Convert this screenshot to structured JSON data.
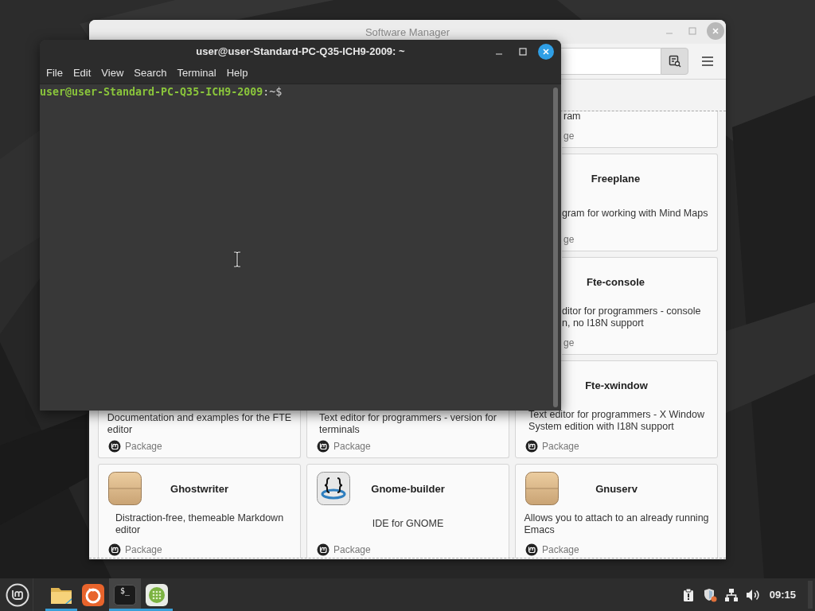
{
  "software_manager": {
    "title": "Software Manager",
    "cards": [
      {
        "kind": "clipped",
        "description": [
          "ram"
        ],
        "source": "ge"
      },
      {
        "kind": "partial",
        "name": "Freeplane",
        "description": [
          "gram for working with Mind Maps"
        ],
        "source": "ge"
      },
      {
        "kind": "partial",
        "name": "Fte-console",
        "description": [
          "ditor for programmers - console",
          "n, no I18N support"
        ],
        "source": "ge"
      },
      {
        "kind": "lower",
        "description": [
          "Documentation and examples for the FTE",
          "editor"
        ],
        "source": "Package"
      },
      {
        "kind": "lower",
        "description": [
          "Text editor for programmers - version for",
          "terminals"
        ],
        "source": "Package"
      },
      {
        "kind": "titled",
        "name": "Fte-xwindow",
        "description": [
          "Text editor for programmers - X Window",
          "System edition with I18N support"
        ],
        "source": "Package"
      },
      {
        "kind": "box",
        "name": "Ghostwriter",
        "description": [
          "Distraction-free, themeable Markdown",
          "editor"
        ],
        "source": "Package"
      },
      {
        "kind": "braces",
        "name": "Gnome-builder",
        "description": [
          "IDE for GNOME"
        ],
        "source": "Package"
      },
      {
        "kind": "box",
        "name": "Gnuserv",
        "description": [
          "Allows you to attach to an already running",
          "Emacs"
        ],
        "source": "Package"
      }
    ]
  },
  "terminal": {
    "title": "user@user-Standard-PC-Q35-ICH9-2009: ~",
    "menu": [
      "File",
      "Edit",
      "View",
      "Search",
      "Terminal",
      "Help"
    ],
    "prompt_user": "user@user-Standard-PC-Q35-ICH9-2009",
    "prompt_rest": ":~$"
  },
  "taskbar": {
    "apps": [
      {
        "kind": "folder",
        "running": true,
        "selected": false
      },
      {
        "kind": "browser",
        "running": false,
        "selected": false
      },
      {
        "kind": "terminal",
        "glyph": "$_",
        "running": true,
        "selected": true
      },
      {
        "kind": "apps",
        "running": true,
        "selected": false
      }
    ],
    "tray": [
      {
        "kind": "clipboard"
      },
      {
        "kind": "shield"
      },
      {
        "kind": "network"
      },
      {
        "kind": "volume"
      }
    ],
    "clock": "09:15"
  }
}
